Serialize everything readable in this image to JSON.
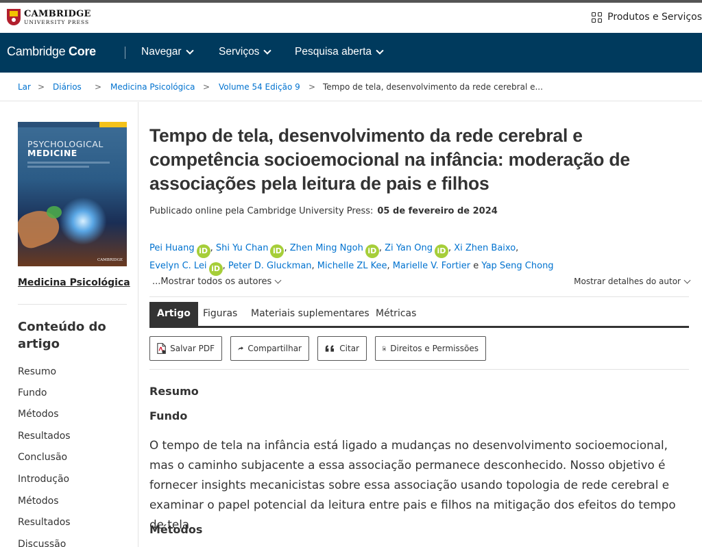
{
  "publisher": {
    "logo_line1": "CAMBRIDGE",
    "logo_line2": "UNIVERSITY PRESS",
    "products_label": "Produtos e Serviços"
  },
  "nav": {
    "brand_light": "Cambridge",
    "brand_bold": "Core",
    "items": [
      {
        "label": "Navegar"
      },
      {
        "label": "Serviços"
      },
      {
        "label": "Pesquisa aberta"
      }
    ]
  },
  "breadcrumb": {
    "items": [
      "Lar",
      "Diários",
      "Medicina Psicológica",
      "Volume 54 Edição 9"
    ],
    "current": "Tempo de tela, desenvolvimento da rede cerebral e..."
  },
  "sidebar": {
    "cover_title_line1": "PSYCHOLOGICAL",
    "cover_title_line2": "MEDICINE",
    "cover_brand": "CAMBRIDGE",
    "journal_name": "Medicina Psicológica",
    "toc_title": "Conteúdo do artigo",
    "toc_items": [
      "Resumo",
      "Fundo",
      "Métodos",
      "Resultados",
      "Conclusão",
      "Introdução",
      "Métodos",
      "Resultados",
      "Discussão"
    ]
  },
  "article": {
    "title": "Tempo de tela, desenvolvimento da rede cerebral e competência socioemocional na infância: moderação de associações pela leitura de pais e filhos",
    "published_label": "Publicado online pela Cambridge University Press:",
    "published_date": "05 de fevereiro de 2024",
    "orcid_label": "iD",
    "authors": [
      {
        "name": "Pei Huang",
        "orcid": true
      },
      {
        "name": "Shi Yu Chan",
        "orcid": true
      },
      {
        "name": "Zhen Ming Ngoh",
        "orcid": true
      },
      {
        "name": "Zi Yan Ong",
        "orcid": true
      },
      {
        "name": "Xi Zhen Baixo",
        "orcid": false
      },
      {
        "name": "Evelyn C. Lei",
        "orcid": true
      },
      {
        "name": "Peter D. Gluckman",
        "orcid": false
      },
      {
        "name": "Michelle ZL Kee",
        "orcid": false
      },
      {
        "name": "Marielle V. Fortier",
        "orcid": false
      },
      {
        "name": "Yap Seng Chong",
        "orcid": false
      }
    ],
    "author_conjunction": "e",
    "show_all_authors": "...Mostrar todos os autores",
    "show_author_details": "Mostrar detalhes do autor",
    "tabs": [
      "Artigo",
      "Figuras",
      "Materiais suplementares",
      "Métricas"
    ],
    "active_tab": "Artigo",
    "toolbar": {
      "save_pdf": "Salvar PDF",
      "share": "Compartilhar",
      "cite": "Citar",
      "rights": "Direitos e Permissões"
    },
    "abstract_heading": "Resumo",
    "background_heading": "Fundo",
    "background_text": "O tempo de tela na infância está ligado a mudanças no desenvolvimento socioemocional, mas o caminho subjacente a essa associação permanece desconhecido. Nosso objetivo é fornecer insights mecanicistas sobre essa associação usando topologia de rede cerebral e examinar o papel potencial da leitura entre pais e filhos na mitigação dos efeitos do tempo de tela.",
    "methods_heading": "Métodos"
  },
  "colors": {
    "nav_bg": "#003a5d",
    "link": "#0072cf",
    "orcid": "#a6ce39",
    "active_tab": "#333333"
  }
}
